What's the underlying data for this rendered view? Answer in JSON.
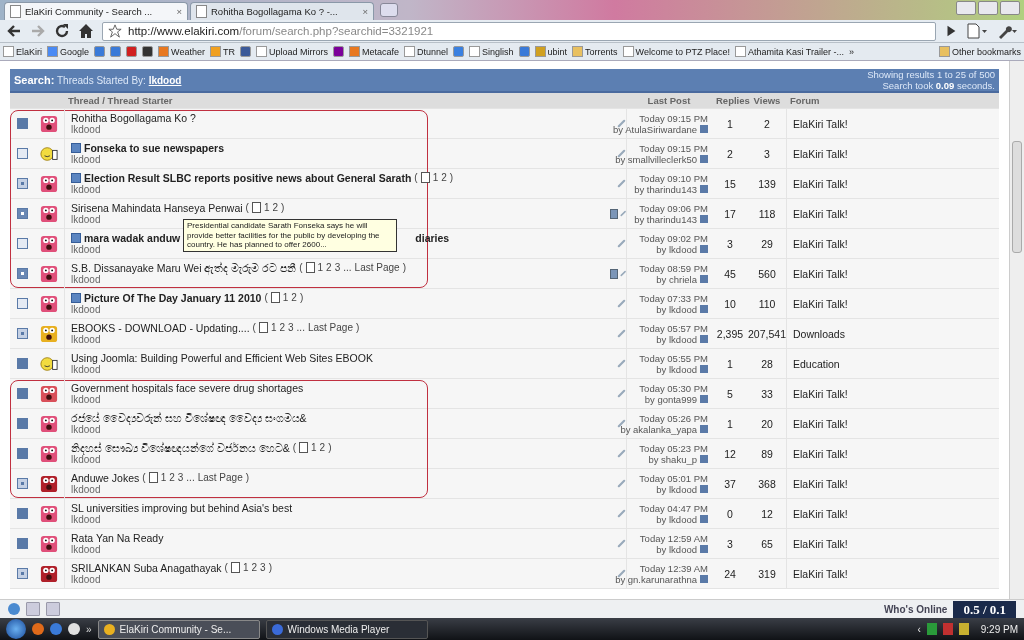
{
  "browser": {
    "close": "×",
    "tabs": [
      {
        "title": "ElaKiri Community - Search ...",
        "selected": true
      },
      {
        "title": "Rohitha Bogollagama Ko ? -...",
        "selected": false
      }
    ],
    "address": {
      "host": "http://www.elakiri.com",
      "path": "/forum/search.php?searchid=3321921"
    },
    "bookmarks": [
      {
        "label": "ElaKiri",
        "kind": "page"
      },
      {
        "label": "Google",
        "kind": "google"
      },
      {
        "kind": "blue"
      },
      {
        "kind": "blue"
      },
      {
        "kind": "tube"
      },
      {
        "kind": "dark"
      },
      {
        "label": "Weather",
        "kind": "weather"
      },
      {
        "label": "TR",
        "kind": "star"
      },
      {
        "kind": "fb"
      },
      {
        "label": "Upload Mirrors",
        "kind": "page"
      },
      {
        "kind": "yahoo"
      },
      {
        "label": "Metacafe",
        "kind": "weather"
      },
      {
        "label": "Dtunnel",
        "kind": "page"
      },
      {
        "kind": "arrow"
      },
      {
        "label": "Singlish",
        "kind": "page"
      },
      {
        "kind": "blue"
      },
      {
        "label": "ubint",
        "kind": "lock"
      },
      {
        "label": "Torrents",
        "kind": "folder"
      },
      {
        "label": "Welcome to PTZ Place!",
        "kind": "page"
      },
      {
        "label": "Athamita Kasi Trailer -...",
        "kind": "page"
      }
    ],
    "more": "»",
    "other": "Other bookmarks"
  },
  "search_header": {
    "label": "Search:",
    "text": "Threads Started By:",
    "user": "lkdood",
    "results": "Showing results 1 to 25 of 500",
    "took_pre": "Search took",
    "took": "0.09",
    "took_post": "seconds."
  },
  "columns": {
    "thread": "Thread / Thread Starter",
    "last_post": "Last Post",
    "replies": "Replies",
    "views": "Views",
    "forum": "Forum"
  },
  "groups": [
    {
      "framed": true,
      "rows": [
        {
          "unread": true,
          "hot": false,
          "kind": "shocked",
          "prefix": false,
          "bold": false,
          "title": "Rohitha Bogollagama Ko ?",
          "starter": "lkdood",
          "extra": false,
          "date": "Today 09:15 PM",
          "by": "by AtulaSiriwardane",
          "replies": "1",
          "views": "2",
          "forum": "ElaKiri Talk!"
        },
        {
          "unread": false,
          "hot": false,
          "kind": "thumbs",
          "prefix": true,
          "bold": true,
          "title": "Fonseka to sue newspapers",
          "starter": "lkdood",
          "extra": false,
          "date": "Today 09:15 PM",
          "by": "by smallvilleclerk50",
          "replies": "2",
          "views": "3",
          "forum": "ElaKiri Talk!"
        },
        {
          "unread": false,
          "hot": true,
          "kind": "shocked",
          "prefix": true,
          "bold": true,
          "title": "Election Result SLBC reports positive news about General Sarath",
          "pages": {
            "open": "(",
            "links": [
              "1",
              "2"
            ],
            "close": ")"
          },
          "starter": "lkdood",
          "extra": false,
          "date": "Today 09:10 PM",
          "by": "by tharindu143",
          "replies": "15",
          "views": "139",
          "forum": "ElaKiri Talk!"
        },
        {
          "unread": true,
          "hot": true,
          "kind": "shocked",
          "prefix": false,
          "bold": false,
          "title": "Sirisena Mahindata Hanseya Penwai",
          "pages": {
            "open": "(",
            "links": [
              "1",
              "2"
            ],
            "close": ")"
          },
          "starter": "lkdood",
          "extra": true,
          "tooltip": "Presidential candidate Sarath Fonseka says he will provide better facilities for the public by developing the country. He has planned to offer 2600...",
          "date": "Today 09:06 PM",
          "by": "by tharindu143",
          "replies": "17",
          "views": "118",
          "forum": "ElaKiri Talk!"
        },
        {
          "unread": false,
          "hot": false,
          "kind": "shocked",
          "prefix": true,
          "bold": true,
          "title": "mara wadak anduw",
          "tail": "diaries",
          "starter": "lkdood",
          "extra": false,
          "date": "Today 09:02 PM",
          "by": "by lkdood",
          "replies": "3",
          "views": "29",
          "forum": "ElaKiri Talk!"
        },
        {
          "unread": true,
          "hot": true,
          "kind": "shocked",
          "prefix": false,
          "bold": false,
          "title": "S.B. Dissanayake Maru Wei ඇත්ද මැරුම රට පනී",
          "pages": {
            "open": "(",
            "links": [
              "1",
              "2",
              "3",
              "...",
              "Last Page"
            ],
            "close": ")"
          },
          "starter": "lkdood",
          "extra": true,
          "date": "Today 08:59 PM",
          "by": "by chriela",
          "replies": "45",
          "views": "560",
          "forum": "ElaKiri Talk!"
        }
      ]
    },
    {
      "framed": false,
      "rows": [
        {
          "unread": false,
          "hot": false,
          "kind": "shocked",
          "prefix": true,
          "bold": true,
          "title": "Picture Of The Day January 11 2010",
          "pages": {
            "open": "(",
            "links": [
              "1",
              "2"
            ],
            "close": ")"
          },
          "starter": "lkdood",
          "extra": false,
          "date": "Today 07:33 PM",
          "by": "by lkdood",
          "replies": "10",
          "views": "110",
          "forum": "ElaKiri Talk!"
        },
        {
          "unread": false,
          "hot": true,
          "kind": "frog",
          "prefix": false,
          "bold": false,
          "title": "EBOOKS - DOWNLOAD - Updating....",
          "pages": {
            "open": "(",
            "links": [
              "1",
              "2",
              "3",
              "...",
              "Last Page"
            ],
            "close": ")"
          },
          "starter": "lkdood",
          "extra": false,
          "date": "Today 05:57 PM",
          "by": "by lkdood",
          "replies": "2,395",
          "views": "207,541",
          "forum": "Downloads"
        },
        {
          "unread": true,
          "hot": false,
          "kind": "thumbs",
          "prefix": false,
          "bold": false,
          "title": "Using Joomla: Building Powerful and Efficient Web Sites EBOOK",
          "starter": "lkdood",
          "extra": false,
          "date": "Today 05:55 PM",
          "by": "by lkdood",
          "replies": "1",
          "views": "28",
          "forum": "Education"
        }
      ]
    },
    {
      "framed": true,
      "rows": [
        {
          "unread": true,
          "hot": false,
          "kind": "red",
          "prefix": false,
          "bold": false,
          "title": "Government hospitals face severe drug shortages",
          "starter": "lkdood",
          "extra": false,
          "date": "Today 05:30 PM",
          "by": "by gonta999",
          "replies": "5",
          "views": "33",
          "forum": "ElaKiri Talk!"
        },
        {
          "unread": true,
          "hot": false,
          "kind": "shocked",
          "prefix": false,
          "bold": false,
          "title": "රජයේ වෛද්‍යවරුන් සහ විශේෂඥ වෛද්‍ය සංගමය&",
          "starter": "lkdood",
          "extra": false,
          "date": "Today 05:26 PM",
          "by": "by akalanka_yapa",
          "replies": "1",
          "views": "20",
          "forum": "ElaKiri Talk!"
        },
        {
          "unread": true,
          "hot": false,
          "kind": "shocked",
          "prefix": false,
          "bold": false,
          "title": "නිදහස් සෞඛ්‍ය විශේෂඥයන්ගේ වර්ජනය හෙට&",
          "pages": {
            "open": "(",
            "links": [
              "1",
              "2"
            ],
            "close": ")"
          },
          "starter": "lkdood",
          "extra": false,
          "date": "Today 05:23 PM",
          "by": "by shaku_p",
          "replies": "12",
          "views": "89",
          "forum": "ElaKiri Talk!"
        },
        {
          "unread": false,
          "hot": true,
          "kind": "angry",
          "prefix": false,
          "bold": false,
          "title": "Anduwe Jokes",
          "pages": {
            "open": "(",
            "links": [
              "1",
              "2",
              "3",
              "...",
              "Last Page"
            ],
            "close": ")"
          },
          "starter": "lkdood",
          "extra": false,
          "date": "Today 05:01 PM",
          "by": "by lkdood",
          "replies": "37",
          "views": "368",
          "forum": "ElaKiri Talk!"
        }
      ]
    },
    {
      "framed": false,
      "rows": [
        {
          "unread": true,
          "hot": false,
          "kind": "shocked",
          "prefix": false,
          "bold": false,
          "title": "SL universities improving but behind Asia's best",
          "starter": "lkdood",
          "extra": false,
          "date": "Today 04:47 PM",
          "by": "by lkdood",
          "replies": "0",
          "views": "12",
          "forum": "ElaKiri Talk!"
        },
        {
          "unread": true,
          "hot": false,
          "kind": "shocked",
          "prefix": false,
          "bold": false,
          "title": "Rata Yan Na Ready",
          "starter": "lkdood",
          "extra": false,
          "date": "Today 12:59 AM",
          "by": "by lkdood",
          "replies": "3",
          "views": "65",
          "forum": "ElaKiri Talk!"
        },
        {
          "unread": false,
          "hot": true,
          "kind": "angry",
          "prefix": false,
          "bold": false,
          "title": "SRILANKAN Suba Anagathayak",
          "pages": {
            "open": "(",
            "links": [
              "1",
              "2",
              "3"
            ],
            "close": ")"
          },
          "starter": "lkdood",
          "extra": false,
          "date": "Today 12:39 AM",
          "by": "by gn.karunarathna",
          "replies": "24",
          "views": "319",
          "forum": "ElaKiri Talk!"
        }
      ]
    }
  ],
  "footer": {
    "whos_online": "Who's Online",
    "counter": "0.5 / 0.1"
  },
  "taskbar": {
    "more": "»",
    "tasks": [
      {
        "title": "ElaKiri Community - Se...",
        "selected": true,
        "kind": "chrome"
      },
      {
        "title": "Windows Media Player",
        "selected": false,
        "kind": "media"
      }
    ],
    "clock": "9:29 PM",
    "tray_arrow": "‹"
  }
}
